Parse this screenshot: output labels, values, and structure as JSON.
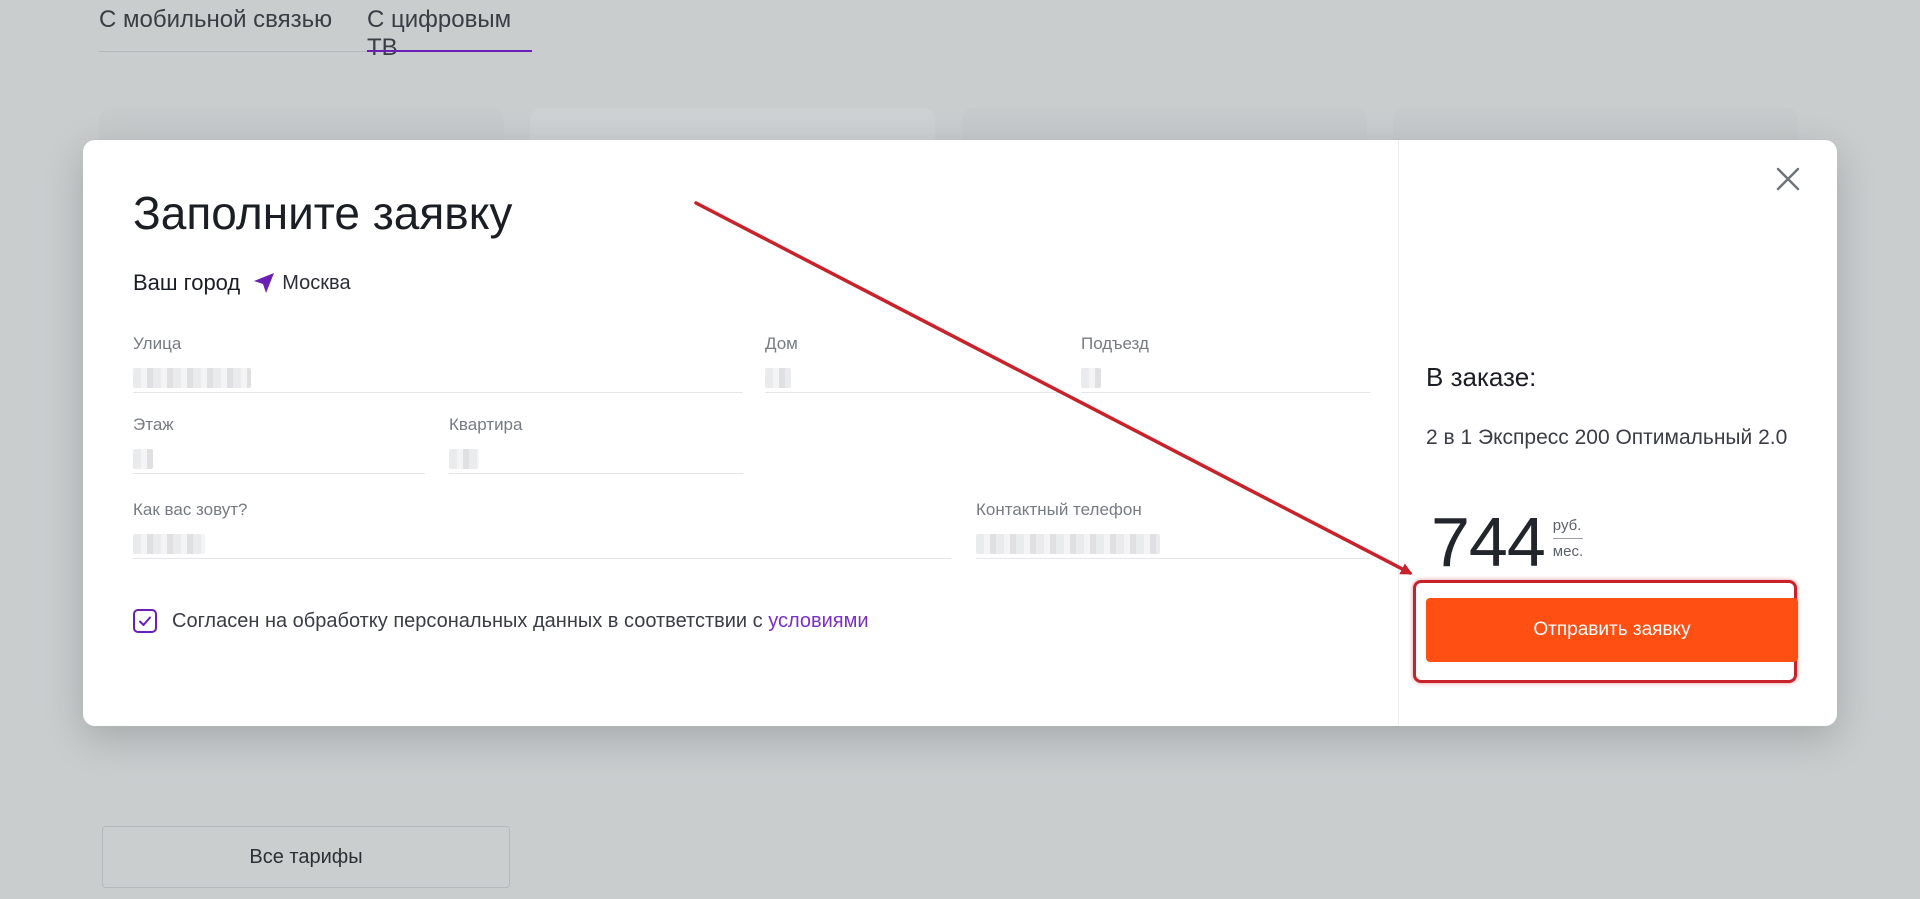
{
  "tabs": [
    {
      "label": "С мобильной связью"
    },
    {
      "label": "С цифровым ТВ"
    }
  ],
  "bottom": {
    "all_tariffs_label": "Все тарифы"
  },
  "modal": {
    "title": "Заполните заявку",
    "city_label": "Ваш город",
    "city_value": "Москва",
    "fields": {
      "street": "Улица",
      "house": "Дом",
      "entrance": "Подъезд",
      "floor": "Этаж",
      "apartment": "Квартира",
      "name": "Как вас зовут?",
      "phone": "Контактный телефон"
    },
    "consent_text": "Согласен на обработку персональных данных в соответствии с ",
    "consent_link": "условиями",
    "consent_checked": true
  },
  "order": {
    "title": "В заказе:",
    "item": "2 в 1 Экспресс 200 Оптимальный 2.0",
    "price": "744",
    "currency": "руб.",
    "period": "мес.",
    "submit_label": "Отправить заявку"
  },
  "colors": {
    "accent_purple": "#6a1fb6",
    "submit_orange": "#ff4f12",
    "annotation_red": "#c8232b",
    "overlay": "#c9cdce"
  },
  "icons": {
    "close": "close-icon",
    "location": "location-arrow-icon",
    "check": "check-icon"
  }
}
